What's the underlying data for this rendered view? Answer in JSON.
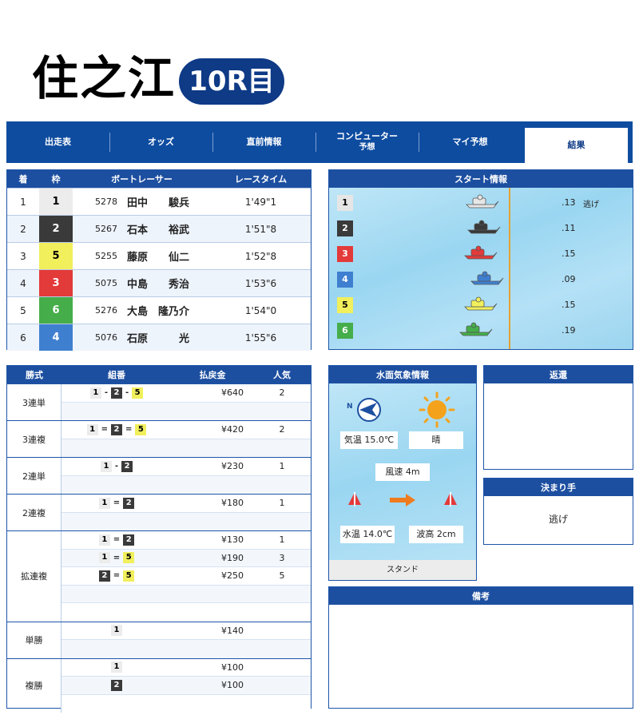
{
  "header": {
    "venue": "住之江",
    "race": "10R目"
  },
  "tabs": [
    {
      "label": "出走表",
      "sub": ""
    },
    {
      "label": "オッズ",
      "sub": ""
    },
    {
      "label": "直前情報",
      "sub": ""
    },
    {
      "label": "コンピューター",
      "sub": "予想"
    },
    {
      "label": "マイ予想",
      "sub": ""
    },
    {
      "label": "結果",
      "sub": ""
    }
  ],
  "results": {
    "headers": [
      "着",
      "枠",
      "ボートレーサー",
      "レースタイム"
    ],
    "rows": [
      {
        "rank": "1",
        "lane": "1",
        "reg": "5278",
        "name": "田中　　駿兵",
        "time": "1'49\"1"
      },
      {
        "rank": "2",
        "lane": "2",
        "reg": "5267",
        "name": "石本　　裕武",
        "time": "1'51\"8"
      },
      {
        "rank": "3",
        "lane": "5",
        "reg": "5255",
        "name": "藤原　　仙二",
        "time": "1'52\"8"
      },
      {
        "rank": "4",
        "lane": "3",
        "reg": "5075",
        "name": "中島　　秀治",
        "time": "1'53\"6"
      },
      {
        "rank": "5",
        "lane": "6",
        "reg": "5276",
        "name": "大島　隆乃介",
        "time": "1'54\"0"
      },
      {
        "rank": "6",
        "lane": "4",
        "reg": "5076",
        "name": "石原　　　光",
        "time": "1'55\"6"
      }
    ]
  },
  "start_info": {
    "title": "スタート情報",
    "rows": [
      {
        "lane": "1",
        "time": ".13",
        "tag": "逃げ",
        "color": "#e6e6e6"
      },
      {
        "lane": "2",
        "time": ".11",
        "tag": "",
        "color": "#3a3a3a"
      },
      {
        "lane": "3",
        "time": ".15",
        "tag": "",
        "color": "#e33a3a"
      },
      {
        "lane": "4",
        "time": ".09",
        "tag": "",
        "color": "#3f7fd0"
      },
      {
        "lane": "5",
        "time": ".15",
        "tag": "",
        "color": "#f1ef5c"
      },
      {
        "lane": "6",
        "time": ".19",
        "tag": "",
        "color": "#45ad4a"
      }
    ]
  },
  "payouts": {
    "headers": [
      "勝式",
      "組番",
      "払戻金",
      "人気"
    ],
    "groups": [
      {
        "label": "3連単",
        "rows": [
          {
            "combo": [
              "1",
              "-",
              "2",
              "-",
              "5"
            ],
            "amount": "¥640",
            "pop": "2"
          },
          {
            "combo": [],
            "amount": "",
            "pop": ""
          }
        ]
      },
      {
        "label": "3連複",
        "rows": [
          {
            "combo": [
              "1",
              "=",
              "2",
              "=",
              "5"
            ],
            "amount": "¥420",
            "pop": "2"
          },
          {
            "combo": [],
            "amount": "",
            "pop": ""
          }
        ]
      },
      {
        "label": "2連単",
        "rows": [
          {
            "combo": [
              "1",
              "-",
              "2"
            ],
            "amount": "¥230",
            "pop": "1"
          },
          {
            "combo": [],
            "amount": "",
            "pop": ""
          }
        ]
      },
      {
        "label": "2連複",
        "rows": [
          {
            "combo": [
              "1",
              "=",
              "2"
            ],
            "amount": "¥180",
            "pop": "1"
          },
          {
            "combo": [],
            "amount": "",
            "pop": ""
          }
        ]
      },
      {
        "label": "拡連複",
        "rows": [
          {
            "combo": [
              "1",
              "=",
              "2"
            ],
            "amount": "¥130",
            "pop": "1"
          },
          {
            "combo": [
              "1",
              "=",
              "5"
            ],
            "amount": "¥190",
            "pop": "3"
          },
          {
            "combo": [
              "2",
              "=",
              "5"
            ],
            "amount": "¥250",
            "pop": "5"
          },
          {
            "combo": [],
            "amount": "",
            "pop": ""
          },
          {
            "combo": [],
            "amount": "",
            "pop": ""
          }
        ]
      },
      {
        "label": "単勝",
        "rows": [
          {
            "combo": [
              "1"
            ],
            "amount": "¥140",
            "pop": ""
          },
          {
            "combo": [],
            "amount": "",
            "pop": ""
          }
        ]
      },
      {
        "label": "複勝",
        "rows": [
          {
            "combo": [
              "1"
            ],
            "amount": "¥100",
            "pop": ""
          },
          {
            "combo": [
              "2"
            ],
            "amount": "¥100",
            "pop": ""
          },
          {
            "combo": [],
            "amount": "",
            "pop": ""
          }
        ]
      }
    ]
  },
  "weather": {
    "title": "水面気象情報",
    "wind_dir_label": "N",
    "air_temp": "気温  15.0℃",
    "sky": "晴",
    "wind_speed": "風速  4m",
    "water_temp": "水温  14.0℃",
    "wave": "波高  2cm",
    "stand": "スタンド"
  },
  "refund": {
    "title": "返還"
  },
  "kimarite": {
    "title": "決まり手",
    "value": "逃げ"
  },
  "notes": {
    "title": "備考"
  },
  "colors": {
    "navy": "#0e3a86",
    "panel_header": "#1d4fa0",
    "lane1": "#ececec",
    "lane2": "#3a3a3a",
    "lane3": "#e33a3a",
    "lane4": "#3f7fd0",
    "lane5": "#f1ef5c",
    "lane6": "#45ad4a",
    "start_line": "#e3a233"
  }
}
